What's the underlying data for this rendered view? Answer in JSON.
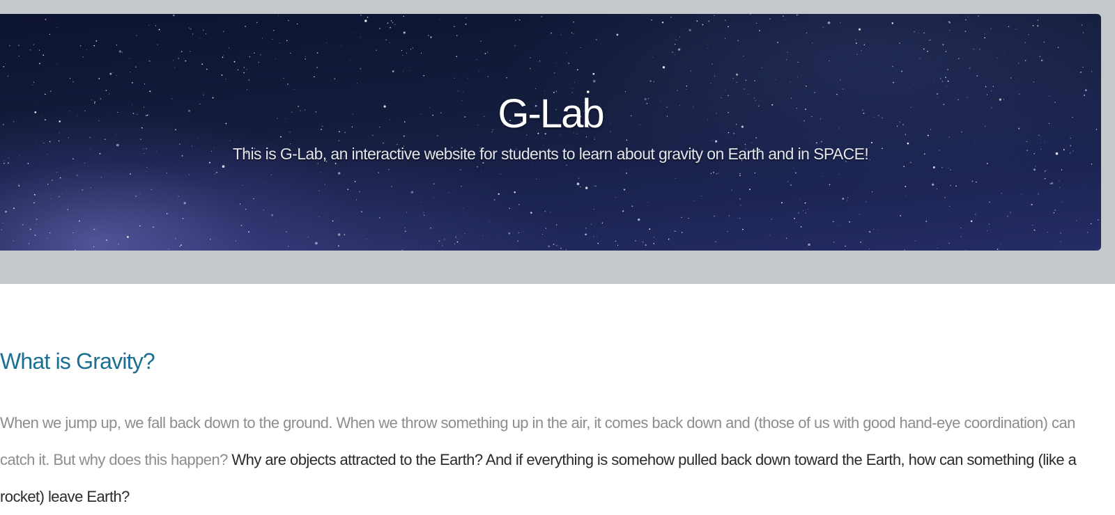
{
  "hero": {
    "title": "G-Lab",
    "subtitle": "This is G-Lab, an interactive website for students to learn about gravity on Earth and in SPACE!"
  },
  "section": {
    "heading": "What is Gravity?",
    "paragraph_muted": "When we jump up, we fall back down to the ground. When we throw something up in the air, it comes back down and (those of us with good hand-eye coordination) can catch it. But why does this happen?",
    "paragraph_dark": "Why are objects attracted to the Earth? And if everything is somehow pulled back down toward the Earth, how can something (like a rocket) leave Earth?"
  },
  "colors": {
    "band": "#c6c9cb",
    "heading": "#1b6f92",
    "muted_text": "#8b8e8a",
    "dark_text": "#2b2b2b"
  }
}
